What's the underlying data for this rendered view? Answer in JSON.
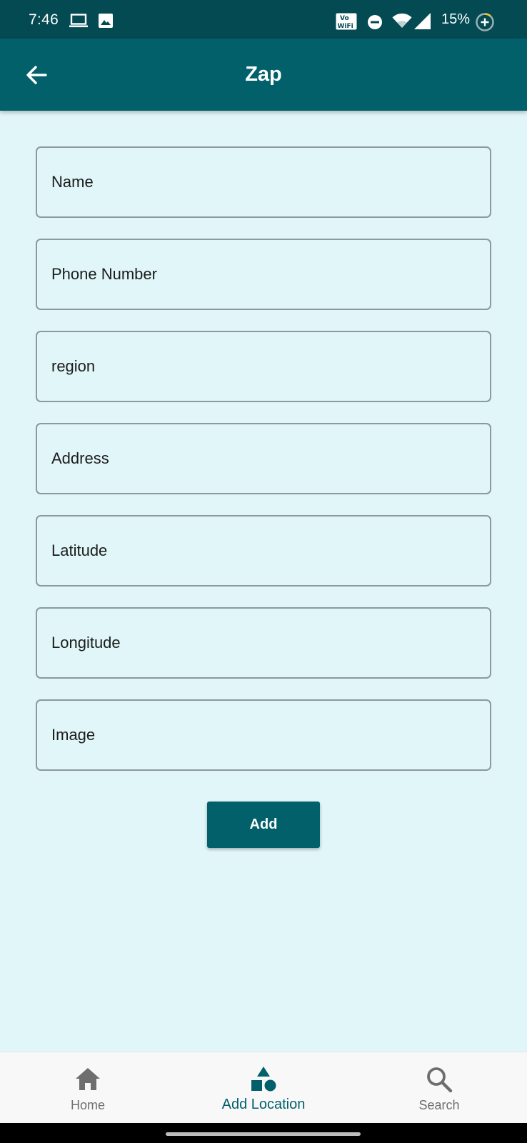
{
  "status_bar": {
    "time": "7:46",
    "vowifi_line1": "Vo",
    "vowifi_line2": "WiFi",
    "battery_percent": "15%",
    "icons": [
      "laptop-icon",
      "gallery-icon",
      "vowifi-icon",
      "dnd-icon",
      "wifi-icon",
      "signal-icon",
      "battery-saver-icon"
    ]
  },
  "app_bar": {
    "title": "Zap",
    "back_icon": "arrow-left-icon"
  },
  "form": {
    "fields": [
      {
        "placeholder": "Name",
        "value": ""
      },
      {
        "placeholder": "Phone Number",
        "value": ""
      },
      {
        "placeholder": "region",
        "value": ""
      },
      {
        "placeholder": "Address",
        "value": ""
      },
      {
        "placeholder": "Latitude",
        "value": ""
      },
      {
        "placeholder": "Longitude",
        "value": ""
      },
      {
        "placeholder": "Image",
        "value": ""
      }
    ],
    "submit_label": "Add"
  },
  "bottom_nav": {
    "items": [
      {
        "label": "Home",
        "icon": "home-icon",
        "active": false
      },
      {
        "label": "Add Location",
        "icon": "shapes-icon",
        "active": true
      },
      {
        "label": "Search",
        "icon": "search-icon",
        "active": false
      }
    ]
  },
  "colors": {
    "status_bar": "#034a53",
    "primary": "#02606a",
    "background": "#e0f6f8",
    "field_border": "#8b9a9d",
    "inactive_nav": "#6e6e6e"
  }
}
